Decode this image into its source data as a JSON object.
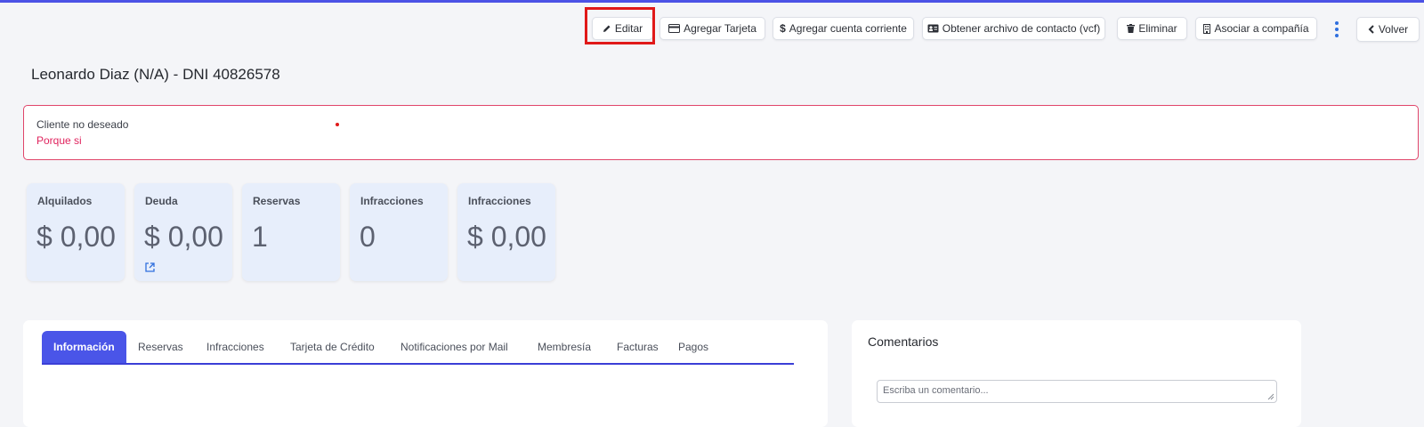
{
  "toolbar": {
    "edit_label": "Editar",
    "add_card_label": "Agregar Tarjeta",
    "add_account_label": "Agregar cuenta corriente",
    "vcf_label": "Obtener archivo de contacto (vcf)",
    "delete_label": "Eliminar",
    "associate_label": "Asociar a compañía",
    "back_label": "Volver"
  },
  "page": {
    "title": "Leonardo Diaz (N/A) - DNI 40826578"
  },
  "alert": {
    "title": "Cliente no deseado",
    "reason": "Porque si"
  },
  "stats": [
    {
      "label": "Alquilados",
      "value": "$ 0,00"
    },
    {
      "label": "Deuda",
      "value": "$ 0,00"
    },
    {
      "label": "Reservas",
      "value": "1"
    },
    {
      "label": "Infracciones",
      "value": "0"
    },
    {
      "label": "Infracciones",
      "value": "$ 0,00"
    }
  ],
  "tabs": [
    {
      "label": "Información",
      "active": true
    },
    {
      "label": "Reservas"
    },
    {
      "label": "Infracciones"
    },
    {
      "label": "Tarjeta de Crédito"
    },
    {
      "label": "Notificaciones por Mail"
    },
    {
      "label": "Membresía"
    },
    {
      "label": "Facturas"
    },
    {
      "label": "Pagos"
    }
  ],
  "comments": {
    "title": "Comentarios",
    "placeholder": "Escriba un comentario..."
  },
  "colors": {
    "accent": "#4a55e8",
    "danger": "#e0245e",
    "card_bg": "#e7eefb",
    "highlight": "#e01919"
  }
}
